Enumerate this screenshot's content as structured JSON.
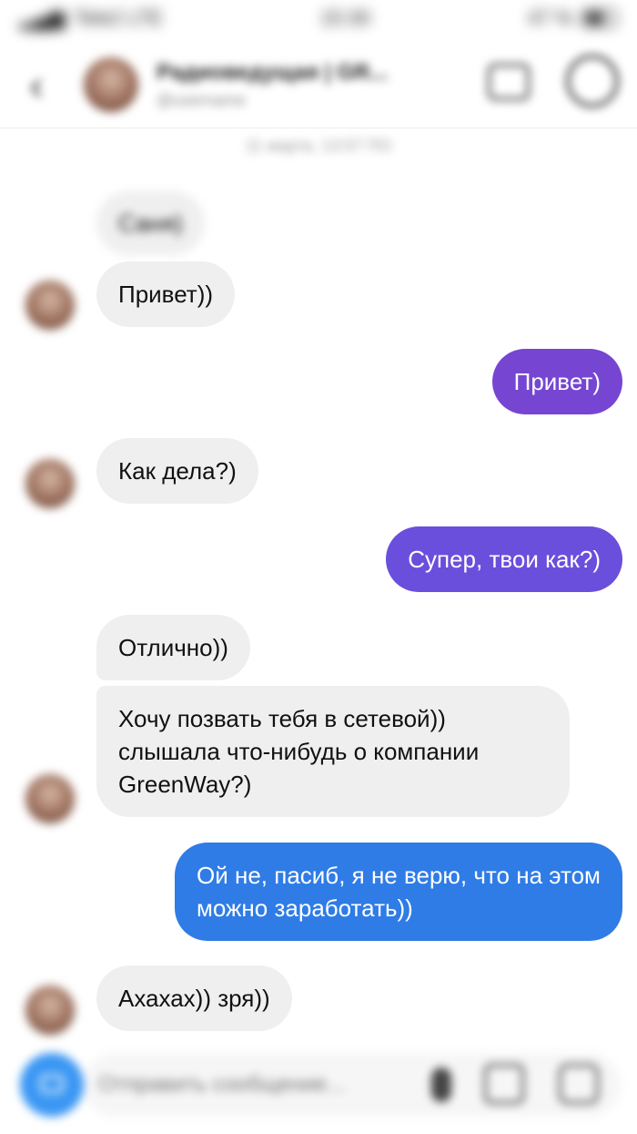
{
  "status_bar": {
    "carrier": "Tele2 LTE",
    "time": "15:30",
    "battery": "47 %"
  },
  "header": {
    "name": "Радиоведущая | GR...",
    "subtitle": "@username"
  },
  "conversation": {
    "timestamp": "11 марта, 13:57 ПО",
    "messages": [
      {
        "side": "in",
        "text": "Саня)",
        "blurred": true
      },
      {
        "side": "in",
        "text": "Привет))"
      },
      {
        "side": "out",
        "text": "Привет)",
        "color": "#7646d2"
      },
      {
        "side": "in",
        "text": "Как дела?)"
      },
      {
        "side": "out",
        "text": "Супер, твои как?)",
        "color": "#6a4fdc"
      },
      {
        "side": "in",
        "text": "Отлично))"
      },
      {
        "side": "in",
        "text": "Хочу позвать тебя в сетевой)) слышала что-нибудь о компании GreenWay?)"
      },
      {
        "side": "out",
        "text": "Ой не, пасиб, я не верю, что на этом можно заработать))",
        "color": "#2f7ce6"
      },
      {
        "side": "in",
        "text": "Ахахах)) зря))"
      }
    ]
  },
  "composer": {
    "placeholder": "Отправить сообщение..."
  },
  "colors": {
    "incoming_bubble": "#efefef",
    "camera_button": "#3b97f3"
  }
}
